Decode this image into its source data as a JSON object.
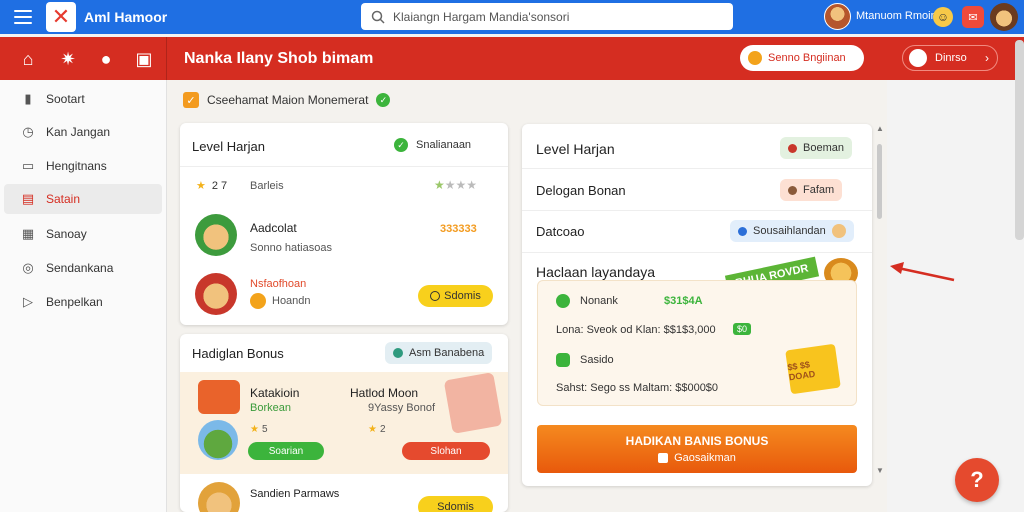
{
  "header": {
    "app_title": "Aml Hamoor",
    "search_placeholder": "Klaiangn Hargam Mandia'sonsori",
    "user_name": "Mtanuom Rmoin"
  },
  "toolbar": {
    "title": "Nanka Ilany  Shob bimam",
    "coin_button": "Senno Bngiinan",
    "profile_button": "Dinrso"
  },
  "sidebar": {
    "items": [
      {
        "label": "Sootart",
        "icon": "bar-chart-icon"
      },
      {
        "label": "Kan Jangan",
        "icon": "clock-icon"
      },
      {
        "label": "Hengitnans",
        "icon": "screen-icon"
      },
      {
        "label": "Satain",
        "icon": "calendar-icon",
        "active": true
      },
      {
        "label": "Sanoay",
        "icon": "dashboard-icon"
      },
      {
        "label": "Sendankana",
        "icon": "settings-icon"
      },
      {
        "label": "Benpelkan",
        "icon": "play-icon"
      }
    ]
  },
  "main": {
    "check_label": "Cseehamat Maion Monemerat",
    "level_card": {
      "title": "Level Harjan",
      "status": "Snalianaan",
      "stars_left": "2 7",
      "stars_label": "Barleis",
      "rows": [
        {
          "name": "Aadcolat",
          "sub": "Sonno hatiasoas",
          "value": "333333"
        },
        {
          "name": "Nsfaofhoan",
          "sub": "Hoandn",
          "button": "Sdomis"
        }
      ]
    },
    "bonus_card": {
      "title": "Hadiglan Bonus",
      "tag": "Asm Banabena",
      "items": [
        {
          "name": "Katakioin",
          "sub": "Borkean",
          "stars": "5",
          "button": "Soarian"
        },
        {
          "name": "Hatlod Moon",
          "sub": "9Yassy Bonof",
          "stars": "2",
          "button": "Slohan"
        }
      ],
      "footer_name": "Sandien Parmaws",
      "footer_button": "Sdomis"
    },
    "right_card": {
      "rows": [
        {
          "label": "Level Harjan",
          "tag": "Boeman",
          "tag_color": "#e3f1e0"
        },
        {
          "label": "Delogan Bonan",
          "tag": "Fafam",
          "tag_color": "#fde0d3"
        },
        {
          "label": "Datcoao",
          "tag": "Sousaihlandan",
          "tag_color": "#e2eefb"
        }
      ],
      "bonus_title": "Haclaan layandaya",
      "ribbon": "BHUA ROVDR",
      "bonus_lines": [
        {
          "label": "Nonank",
          "value": "$31$4A"
        },
        {
          "label": "Lona: Sveok od Klan: $$1$3,000",
          "badge": "$0"
        },
        {
          "label": "Sasido",
          "value": ""
        },
        {
          "label": "Sahst: Sego ss Maltam: $$000$0",
          "value": ""
        }
      ],
      "ticket_text": "$$ $$ DOAD",
      "cta_title": "HADIKAN BANIS BONUS",
      "cta_sub": "Gaosaikman"
    }
  }
}
